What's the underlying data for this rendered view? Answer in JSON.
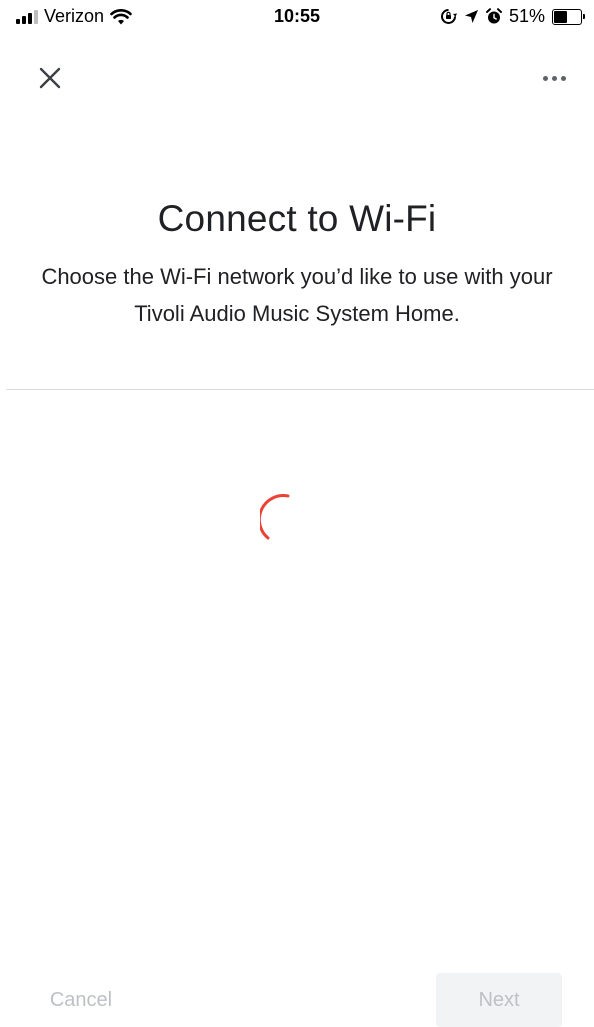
{
  "status_bar": {
    "carrier": "Verizon",
    "time": "10:55",
    "battery_percent": "51%",
    "battery_level": 0.51,
    "icons": [
      "signal-icon",
      "wifi-icon",
      "rotation-lock-icon",
      "location-arrow-icon",
      "alarm-icon",
      "battery-icon"
    ]
  },
  "header": {
    "close_icon": "close-icon",
    "more_icon": "more-horizontal-icon"
  },
  "main": {
    "title": "Connect to Wi-Fi",
    "subtitle": "Choose the Wi-Fi network you’d like to use with your Tivoli Audio Music System Home.",
    "loading_indicator": "spinner-icon"
  },
  "footer": {
    "cancel_label": "Cancel",
    "next_label": "Next"
  },
  "colors": {
    "spinner": "#ea4335",
    "disabled_text": "#bdc1c6",
    "disabled_button_bg": "#f1f3f4",
    "divider": "#dadce0"
  }
}
